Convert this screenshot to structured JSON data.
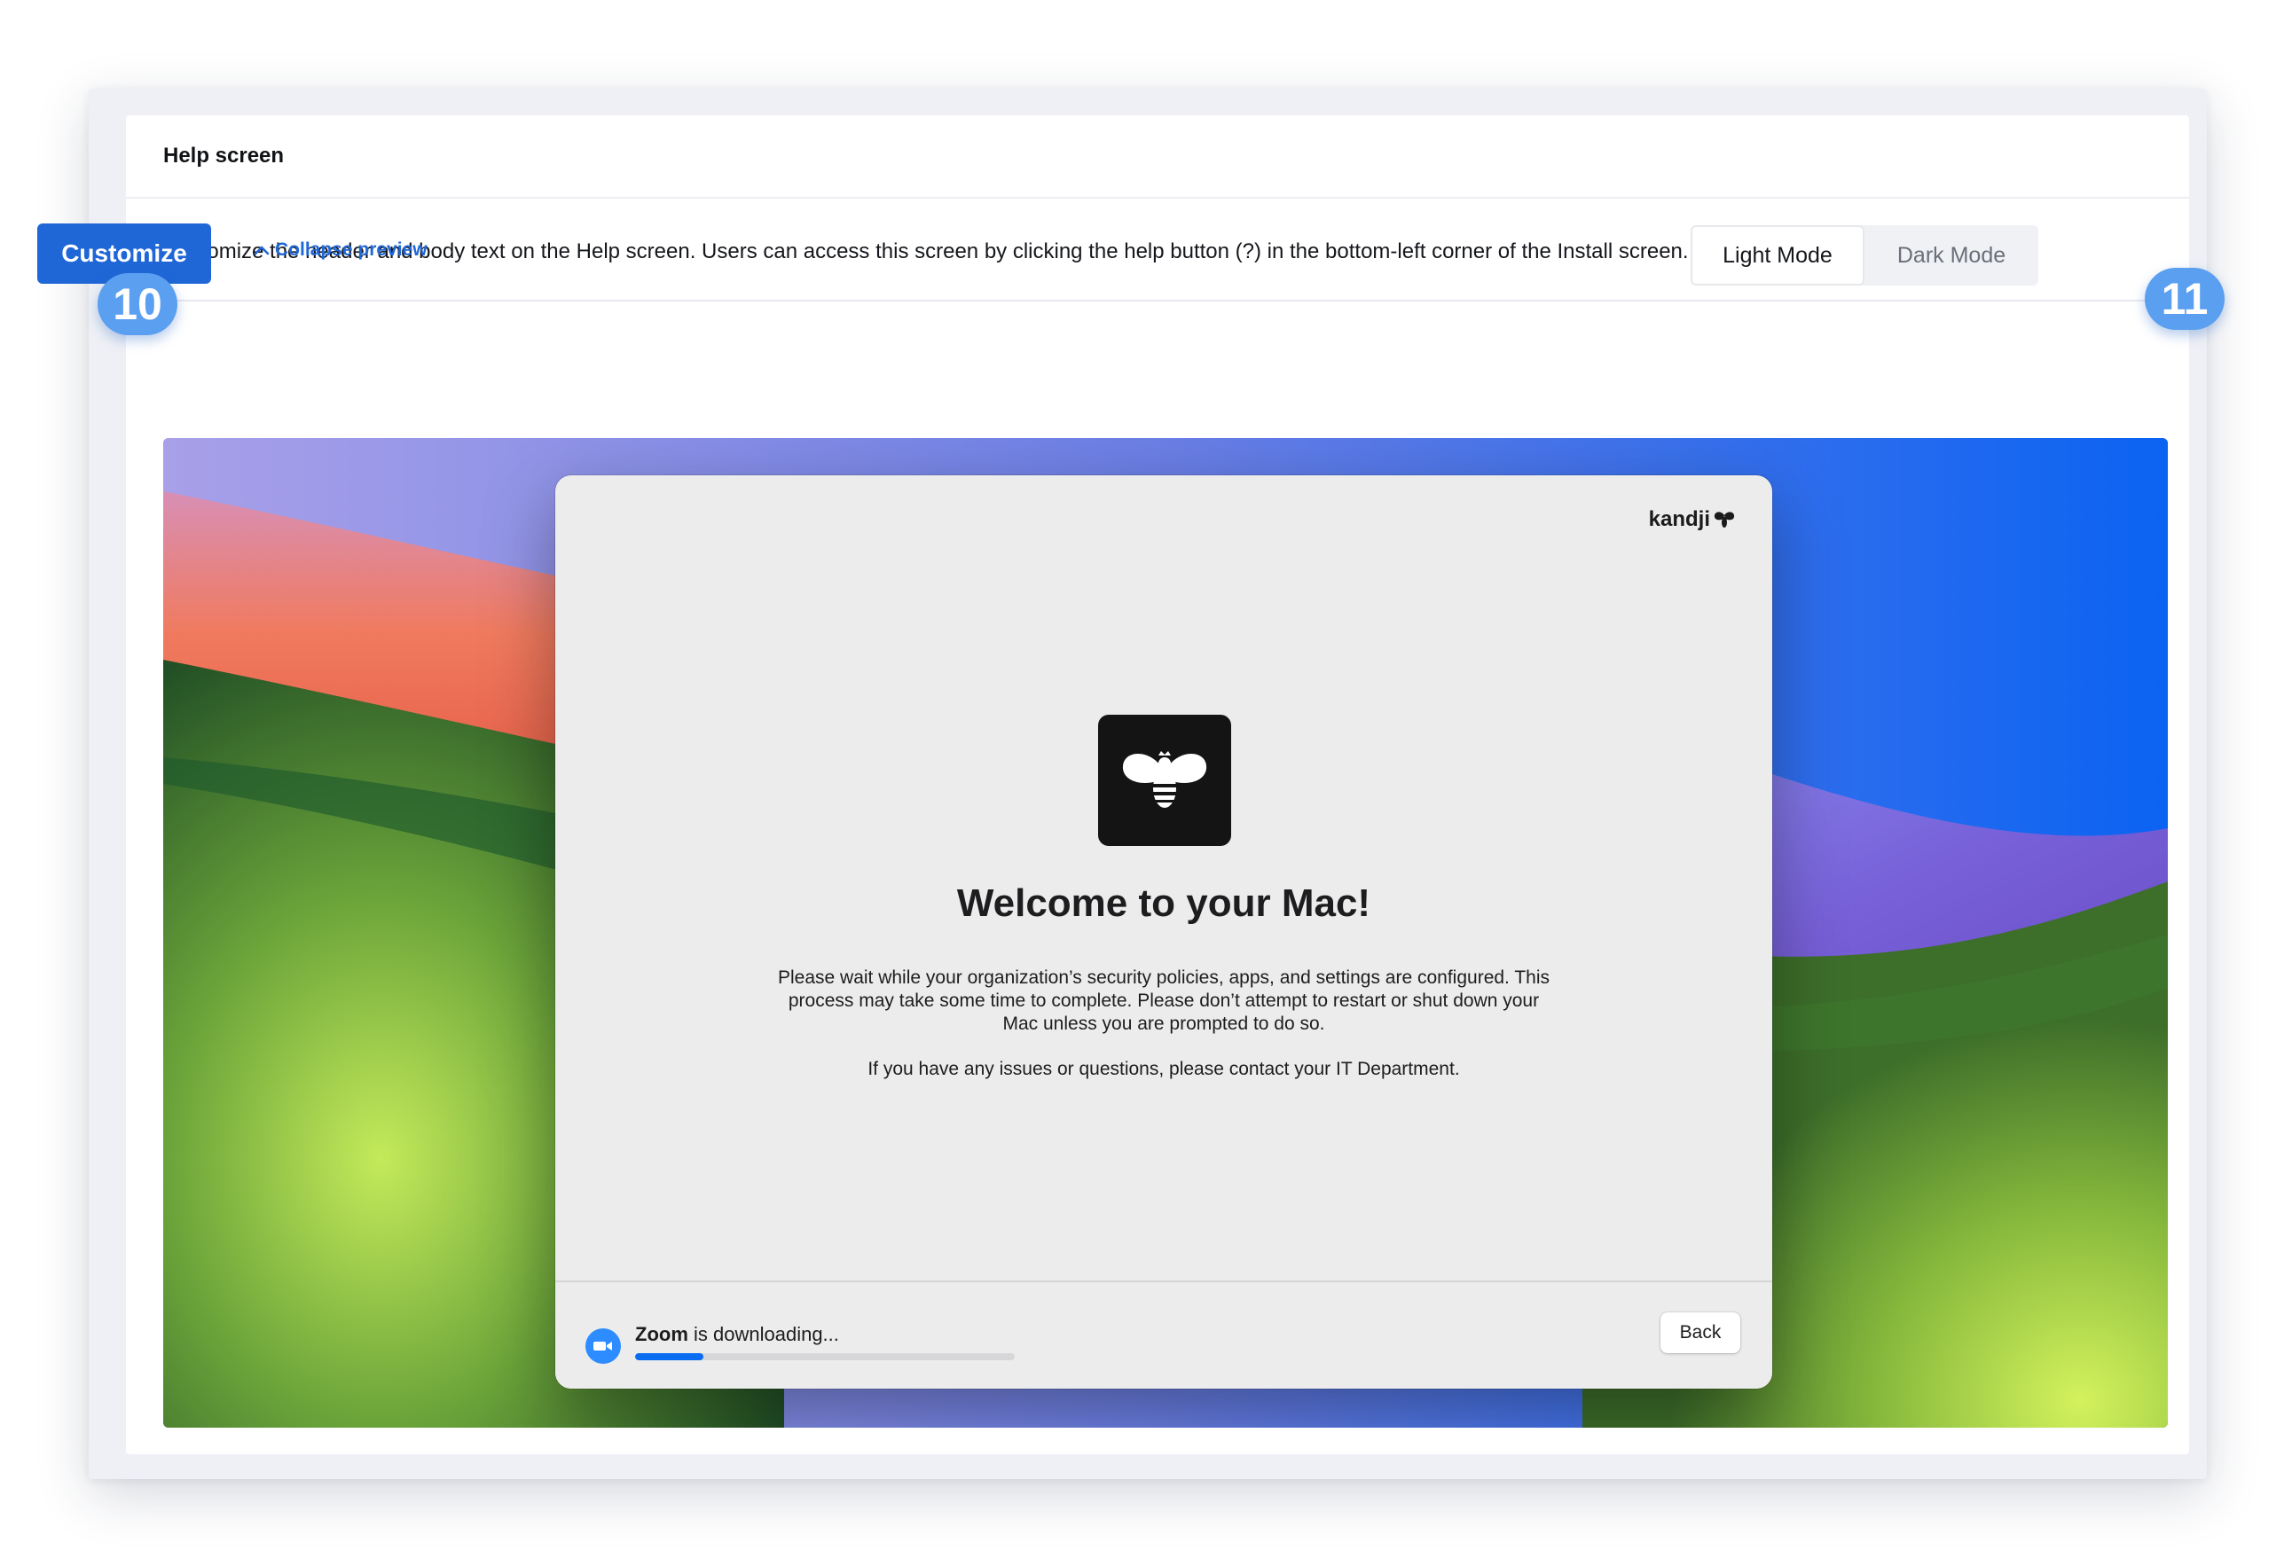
{
  "section": {
    "title": "Help screen",
    "description": "Customize the header and body text on the Help screen. Users can access this screen by clicking the help button (?) in the bottom-left corner of the Install screen."
  },
  "toolbar": {
    "customize_label": "Customize",
    "collapse_label": "Collapse preview",
    "modes": [
      {
        "label": "Light Mode",
        "active": true
      },
      {
        "label": "Dark Mode",
        "active": false
      }
    ]
  },
  "callouts": {
    "left": "10",
    "right": "11"
  },
  "preview": {
    "brand": "kandji",
    "icon": "bee-icon",
    "welcome_title": "Welcome to your Mac!",
    "welcome_body": "Please wait while your organization’s security policies, apps, and settings are configured. This process may take some time to complete. Please don’t attempt to restart or shut down your Mac unless you are prompted to do so.",
    "welcome_contact": "If you have any issues or questions, please contact your IT Department.",
    "download": {
      "app_name": "Zoom",
      "status_text": "is downloading...",
      "progress": 0.18
    },
    "back_label": "Back"
  },
  "colors": {
    "accent": "#1f66d6",
    "badge": "#5a9ff0",
    "progress": "#0a6cf0"
  }
}
